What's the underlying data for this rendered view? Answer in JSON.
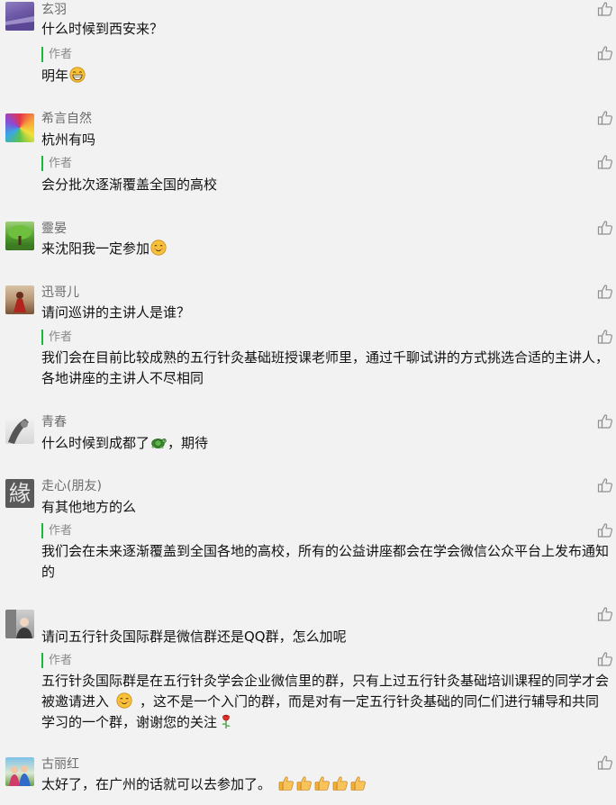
{
  "author_label": "作者",
  "comments": [
    {
      "nickname": "玄羽",
      "text": "什么时候到西安来？",
      "reply": "明年"
    },
    {
      "nickname": "希言自然",
      "text": "杭州有吗",
      "reply": "会分批次逐渐覆盖全国的高校"
    },
    {
      "nickname": "靈晏",
      "text": "来沈阳我一定参加"
    },
    {
      "nickname": "迅哥儿",
      "text": "请问巡讲的主讲人是谁？",
      "reply": "我们会在目前比较成熟的五行针灸基础班授课老师里，通过千聊试讲的方式挑选合适的主讲人，各地讲座的主讲人不尽相同"
    },
    {
      "nickname": "青春",
      "text_before": "什么时候到成都了",
      "text_after": "，期待"
    },
    {
      "nickname": "走心(朋友)",
      "avatar_char": "緣",
      "text": "有其他地方的么",
      "reply": "我们会在未来逐渐覆盖到全国各地的高校，所有的公益讲座都会在学会微信公众平台上发布通知的"
    },
    {
      "nickname": "",
      "text": "请问五行针灸国际群是微信群还是QQ群，怎么加呢",
      "reply_before": "五行针灸国际群是在五行针灸学会企业微信里的群，只有上过五行针灸基础培训课程的同学才会被邀请进入",
      "reply_after": "，这不是一个入门的群，而是对有一定五行针灸基础的同仁们进行辅导和共同学习的一个群，谢谢您的关注"
    },
    {
      "nickname": "古丽红",
      "text": "太好了，在广州的话就可以去参加了。"
    }
  ],
  "icons": {
    "like": "thumbs-up-outline-icon",
    "grin": "grin-emoji-icon",
    "smile": "smile-emoji-icon",
    "turtle": "turtle-emoji-icon",
    "rose": "rose-emoji-icon",
    "thumbs": "thumbs-up-emoji-icon"
  },
  "colors": {
    "background": "#f2f2f2",
    "nickname": "#6b6b6b",
    "author_bar": "#18b83a",
    "text": "#111111"
  }
}
